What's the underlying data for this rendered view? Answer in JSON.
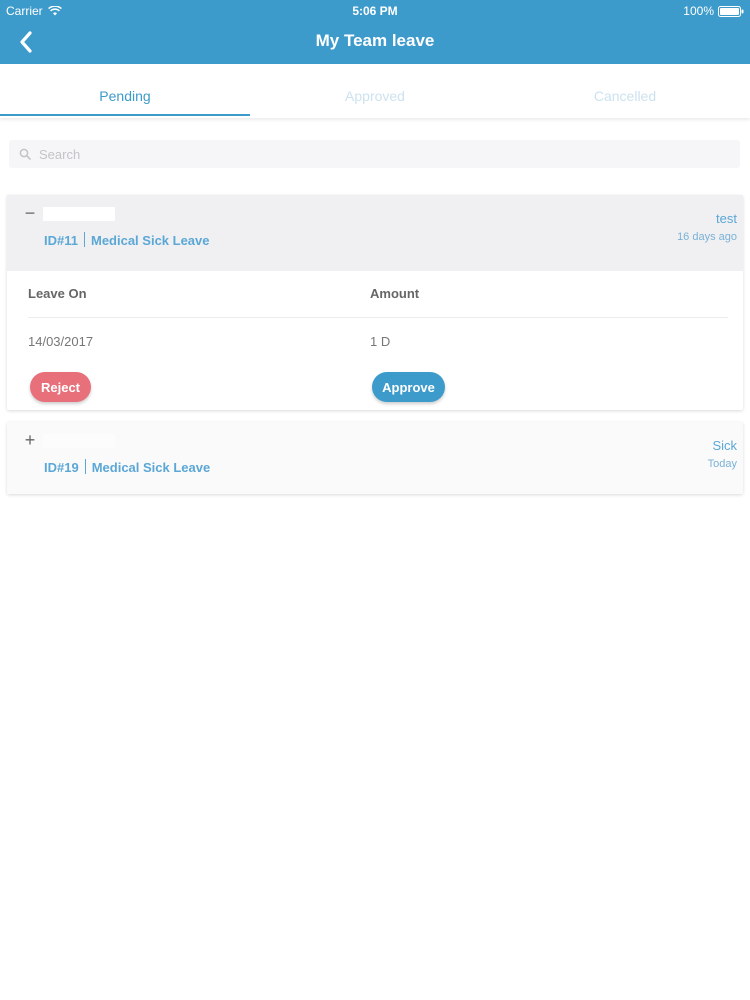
{
  "status_bar": {
    "carrier": "Carrier",
    "time": "5:06 PM",
    "battery": "100%"
  },
  "nav": {
    "title": "My Team leave",
    "back_icon": "chevron-left-icon"
  },
  "tabs": [
    {
      "label": "Pending",
      "active": true
    },
    {
      "label": "Approved",
      "active": false
    },
    {
      "label": "Cancelled",
      "active": false
    }
  ],
  "search": {
    "placeholder": "Search",
    "value": ""
  },
  "requests": [
    {
      "expanded": true,
      "toggle": "−",
      "id": "ID#11",
      "type": "Medical Sick Leave",
      "reason": "test",
      "ago": "16 days ago",
      "details": {
        "col1_header": "Leave On",
        "col2_header": "Amount",
        "leave_on": "14/03/2017",
        "amount": "1 D"
      },
      "reject_label": "Reject",
      "approve_label": "Approve"
    },
    {
      "expanded": false,
      "toggle": "+",
      "id": "ID#19",
      "type": "Medical Sick Leave",
      "reason": "Sick",
      "ago": "Today"
    }
  ],
  "colors": {
    "primary": "#3d9bcb",
    "reject": "#e7707b",
    "link": "#5ba7d6"
  }
}
